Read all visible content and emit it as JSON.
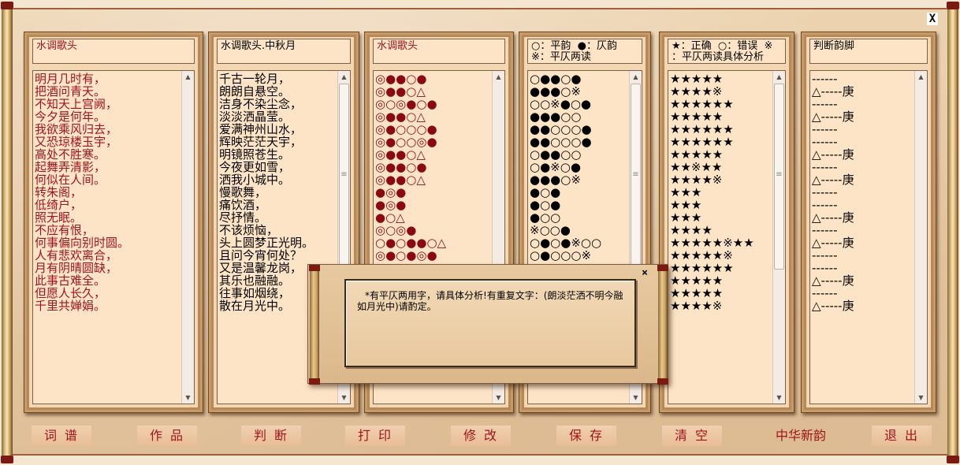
{
  "window": {
    "close_label": "X"
  },
  "panels": [
    {
      "title": "水调歌头",
      "lines": [
        "明月几时有，",
        "把酒问青天。",
        "不知天上宫阙，",
        "今夕是何年。",
        "我欲乘风归去，",
        "又恐琼楼玉宇，",
        "高处不胜寒。",
        "起舞弄清影，",
        "何似在人间。",
        "转朱阁，",
        "低绮户，",
        "照无眠。",
        "不应有恨，",
        "何事偏向别时圆。",
        "人有悲欢离合，",
        "月有阴晴圆缺，",
        "此事古难全。",
        "但愿人长久，",
        "千里共婵娟。"
      ]
    },
    {
      "title": "水调歌头.中秋月",
      "lines": [
        "千古一轮月，",
        "朗朗自悬空。",
        "洁身不染尘念，",
        "淡淡洒晶莹。",
        "爱满神州山水，",
        "辉映茫茫天宇，",
        "明镜照苍生。",
        "今夜更如雪，",
        "洒我小城中。",
        "慢歌舞，",
        "痛饮酒，",
        "尽抒情。",
        "不该烦恼，",
        "头上圆梦正光明。",
        "且问今宵何处？",
        "又是温馨龙岗，",
        "其乐也融融。",
        "往事如烟绕，",
        "散在月光中。"
      ]
    },
    {
      "title": "水调歌头",
      "rows": [
        "◎●●○●",
        "◎●●○△",
        "◎○◎●○●",
        "◎●●○△",
        "◎●○○○●",
        "◎●○○◎●",
        "◎●●○△",
        "◎●●○●",
        "◎●●○△",
        "●◎●",
        "●◎●",
        "●○△",
        "◎○◎●",
        "○●○●●○△",
        "◎●○●◎●",
        "◎●○●○●",
        "◎●●○△",
        "◎●●○●",
        "◎●●○△"
      ]
    },
    {
      "title": "○：平韵  ●：仄韵\n※：平仄两读",
      "rows": [
        "○●●○●",
        "●●●○※",
        "○○※●○●",
        "●●●○○",
        "●●○○○●",
        "●●○○○●",
        "○●●○○",
        "○●※○●",
        "●●●○※",
        "●○●",
        "●○●",
        "●○○",
        "※○○●",
        "○●○●※○○",
        "○●○○○※",
        "○●○●○●",
        "○●●○○",
        "○●●○●",
        "○●●○○"
      ]
    },
    {
      "title": "★：正确  ○：错误  ※\n：平仄两读具体分析",
      "rows": [
        "★★★★★",
        "★★★★※",
        "★★★★★★",
        "★★★★★",
        "★★★★★★",
        "★★★★★★",
        "★★★★★",
        "★★※★★",
        "★★★★※",
        "★★★",
        "★★★",
        "★★★",
        "★★★★",
        "★★★★★※★★",
        "★★★★★※",
        "★★★★★★",
        "★★★★★",
        "★★★★★",
        "★★★★※"
      ]
    },
    {
      "title": "判断韵脚",
      "rows": [
        "------",
        "△-----庚",
        "------",
        "△-----庚",
        "------",
        "------",
        "△-----庚",
        "------",
        "△-----庚",
        "------",
        "------",
        "△-----庚",
        "------",
        "△-----庚",
        "------",
        "------",
        "△-----庚",
        "------",
        "△-----庚"
      ]
    }
  ],
  "buttons": [
    {
      "label": "词谱"
    },
    {
      "label": "作品"
    },
    {
      "label": "判断"
    },
    {
      "label": "打印"
    },
    {
      "label": "修改"
    },
    {
      "label": "保存"
    },
    {
      "label": "清空"
    },
    {
      "label": "中华新韵"
    },
    {
      "label": "退出"
    }
  ],
  "dialog": {
    "close_label": "×",
    "message": "*有平仄两用字，请具体分析!有重复文字：(朗淡茫洒不明今融如月光中)请酌定。"
  }
}
